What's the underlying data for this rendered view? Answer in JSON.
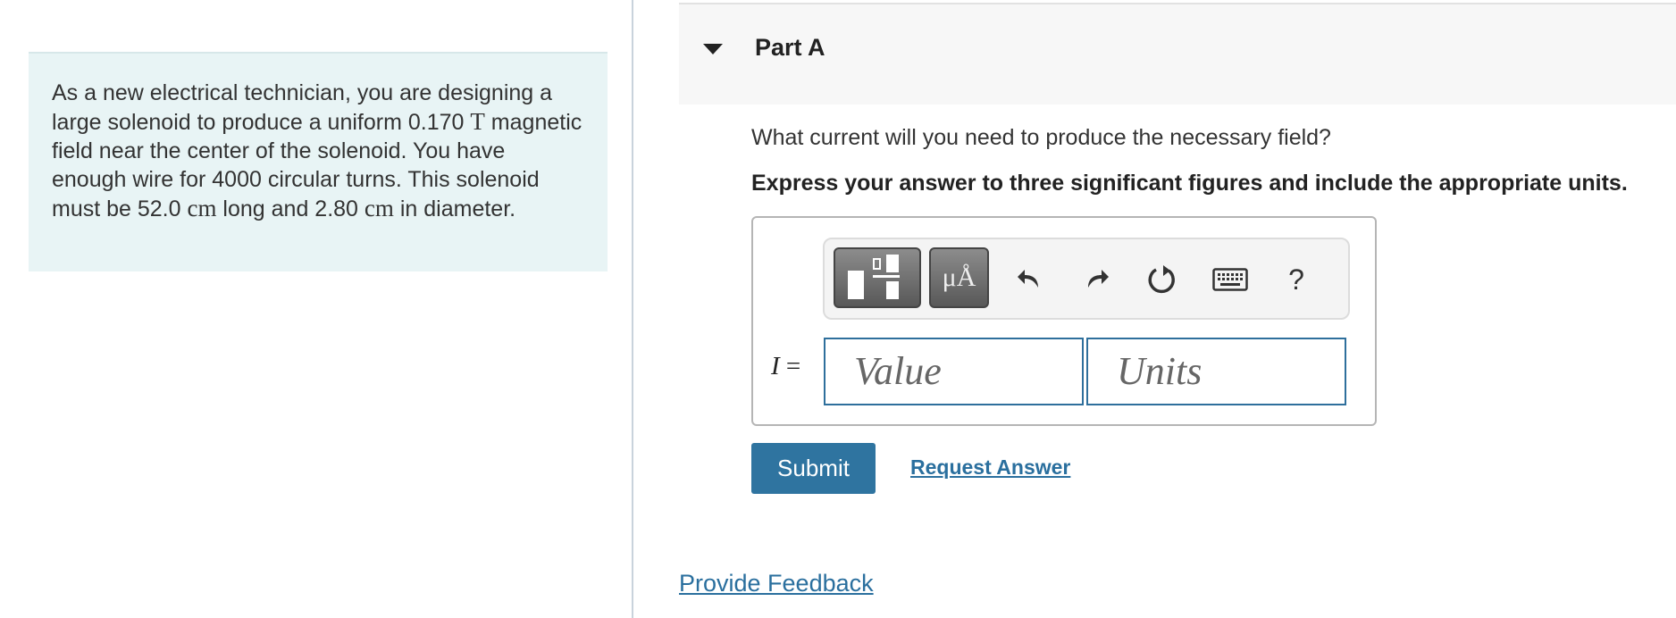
{
  "problem": {
    "text_1": "As a new electrical technician, you are designing a large solenoid to produce a uniform 0.170 ",
    "unit_T": "T",
    "text_2": " magnetic field near the center of the solenoid. You have enough wire for 4000 circular turns. This solenoid must be 52.0 ",
    "unit_cm_1": "cm",
    "text_3": " long and 2.80 ",
    "unit_cm_2": "cm",
    "text_4": " in diameter."
  },
  "part": {
    "title": "Part A",
    "question": "What current will you need to produce the necessary field?",
    "instruction": "Express your answer to three significant figures and include the appropriate units."
  },
  "toolbar": {
    "templates_icon": "fraction-template-icon",
    "units_label": "μÅ",
    "undo_icon": "undo-icon",
    "redo_icon": "redo-icon",
    "reset_icon": "reset-icon",
    "keyboard_icon": "keyboard-icon",
    "help_label": "?"
  },
  "answer": {
    "variable": "I",
    "equals": "=",
    "value_placeholder": "Value",
    "units_placeholder": "Units"
  },
  "actions": {
    "submit_label": "Submit",
    "request_label": "Request Answer",
    "feedback_label": "Provide Feedback"
  },
  "colors": {
    "accent": "#2f74a0",
    "link": "#2a6f9e",
    "problem_bg": "#e8f4f5"
  }
}
